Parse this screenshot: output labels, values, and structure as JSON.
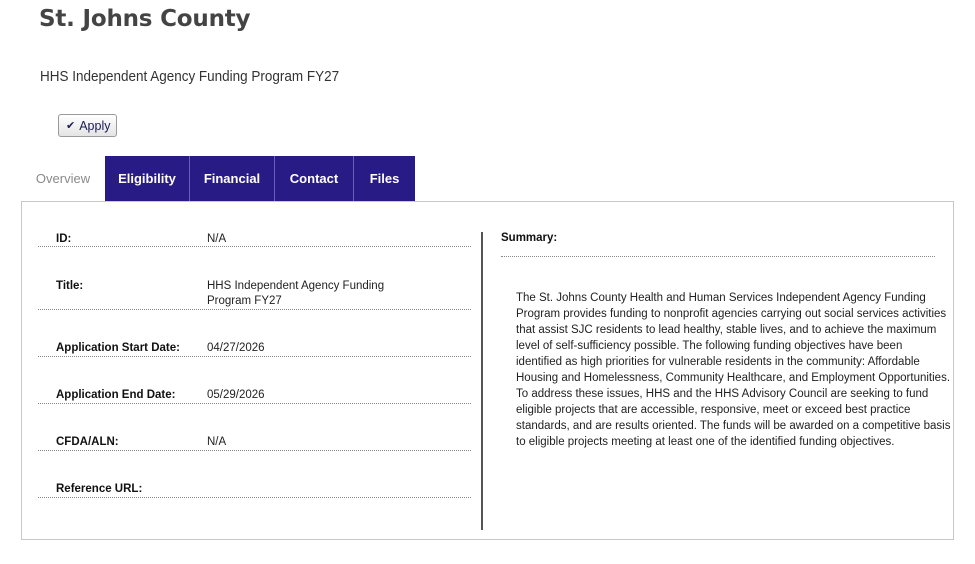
{
  "header": {
    "org_name": "St. Johns County",
    "program_title": "HHS Independent Agency Funding Program FY27"
  },
  "actions": {
    "apply_label": "Apply",
    "apply_icon": "checkmark-icon"
  },
  "tabs": [
    {
      "label": "Overview",
      "active": true
    },
    {
      "label": "Eligibility",
      "active": false
    },
    {
      "label": "Financial",
      "active": false
    },
    {
      "label": "Contact",
      "active": false
    },
    {
      "label": "Files",
      "active": false
    }
  ],
  "fields": {
    "id": {
      "label": "ID:",
      "value": "N/A"
    },
    "title": {
      "label": "Title:",
      "value_line1": "HHS Independent Agency Funding",
      "value_line2": "Program FY27"
    },
    "start_date": {
      "label": "Application Start Date:",
      "value": "04/27/2026"
    },
    "end_date": {
      "label": "Application End Date:",
      "value": "05/29/2026"
    },
    "cfda": {
      "label": "CFDA/ALN:",
      "value": "N/A"
    },
    "reference_url": {
      "label": "Reference URL:",
      "value": ""
    }
  },
  "summary": {
    "label": "Summary:",
    "text": "The St. Johns County Health and Human Services Independent Agency Funding Program provides funding to nonprofit agencies carrying out social services activities that assist SJC residents to lead healthy, stable lives, and to achieve the maximum level of self-sufficiency possible. The following funding objectives have been identified as high priorities for vulnerable residents in the community: Affordable Housing and Homelessness, Community Healthcare, and Employment Opportunities. To address these issues, HHS and the HHS Advisory Council are seeking to fund eligible projects that are accessible, responsive, meet or exceed best practice standards, and are results oriented. The funds will be awarded on a competitive basis to eligible projects meeting at least one of the identified funding objectives."
  },
  "colors": {
    "tab_bg": "#291b85",
    "tab_text": "#ffffff",
    "active_tab_text": "#8a8a8a"
  }
}
